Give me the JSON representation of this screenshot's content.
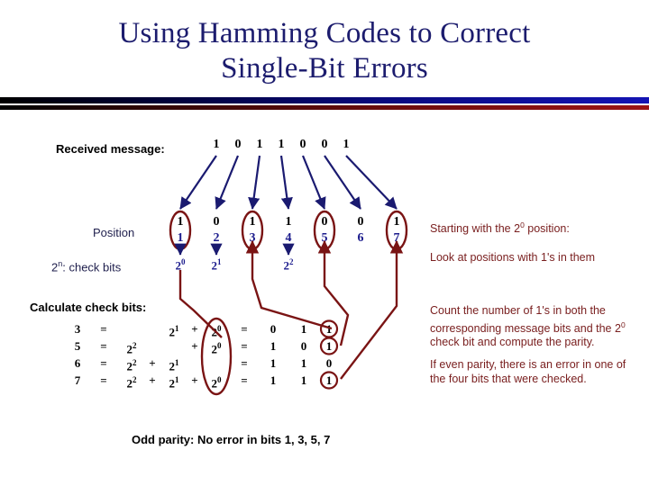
{
  "slide": {
    "title_line1": "Using Hamming Codes to Correct",
    "title_line2": "Single-Bit Errors"
  },
  "labels": {
    "received": "Received message:",
    "position": "Position",
    "check_bits": "2ⁿ: check bits",
    "calculate": "Calculate check bits:",
    "conclusion": "Odd parity: No error in bits 1, 3, 5, 7"
  },
  "message": {
    "bits": [
      "1",
      "0",
      "1",
      "1",
      "0",
      "0",
      "1"
    ]
  },
  "columns": [
    {
      "bit": "1",
      "position": "1",
      "check": "2",
      "check_exp": "0",
      "circled": true
    },
    {
      "bit": "0",
      "position": "2",
      "check": "2",
      "check_exp": "1",
      "circled": false
    },
    {
      "bit": "1",
      "position": "3",
      "check": "",
      "check_exp": "",
      "circled": true
    },
    {
      "bit": "1",
      "position": "4",
      "check": "2",
      "check_exp": "2",
      "circled": false
    },
    {
      "bit": "0",
      "position": "5",
      "check": "",
      "check_exp": "",
      "circled": true
    },
    {
      "bit": "0",
      "position": "6",
      "check": "",
      "check_exp": "",
      "circled": false
    },
    {
      "bit": "1",
      "position": "7",
      "check": "",
      "check_exp": "",
      "circled": true
    }
  ],
  "calc_rows": [
    {
      "n": "3",
      "eq1": "=",
      "t4": "",
      "p1": "",
      "t2": "2¹",
      "p2": "+",
      "t1": "2⁰",
      "eq2": "=",
      "b4": "0",
      "b2": "1",
      "b1": "1",
      "b1_circled": true
    },
    {
      "n": "5",
      "eq1": "=",
      "t4": "2²",
      "p1": "",
      "t2": "",
      "p2": "+",
      "t1": "2⁰",
      "eq2": "=",
      "b4": "1",
      "b2": "0",
      "b1": "1",
      "b1_circled": true
    },
    {
      "n": "6",
      "eq1": "=",
      "t4": "2²",
      "p1": "+",
      "t2": "2¹",
      "p2": "",
      "t1": "",
      "eq2": "=",
      "b4": "1",
      "b2": "1",
      "b1": "0",
      "b1_circled": false
    },
    {
      "n": "7",
      "eq1": "=",
      "t4": "2²",
      "p1": "+",
      "t2": "2¹",
      "p2": "+",
      "t1": "2⁰",
      "eq2": "=",
      "b4": "1",
      "b2": "1",
      "b1": "1",
      "b1_circled": true
    }
  ],
  "notes": {
    "note1": "Starting with the 2⁰ position:",
    "note2": "Look at positions with 1's in them",
    "note3": "Count the number of 1's in both the corresponding message bits and the 2⁰ check bit and compute the parity.",
    "note4": "If even parity, there is an error in one of the four bits that were checked."
  },
  "colors": {
    "title": "#1c1c6e",
    "arrow_navy": "#1a1a70",
    "highlight_red": "#7a1414",
    "note_text": "#7a2020",
    "position_blue": "#1a1a8c"
  }
}
